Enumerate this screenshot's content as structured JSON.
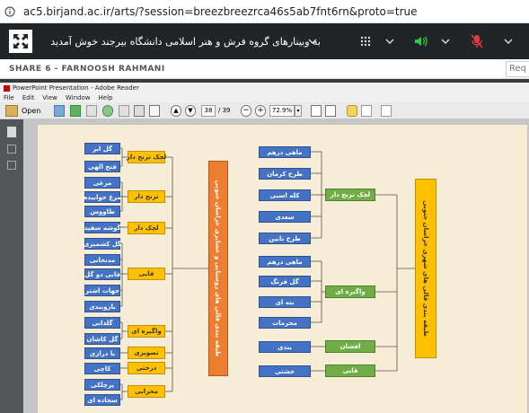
{
  "browser": {
    "url": "ac5.birjand.ac.ir/arts/?session=breezbreezrca46s5ab7fnt6rn&proto=true"
  },
  "meeting": {
    "title": "به وبینارهای گروه فرش و هنر اسلامی دانشگاه بیرجند خوش آمدید",
    "share_label": "SHARE 6  -  FARNOOSH RAHMANI",
    "req_label": "Req",
    "colors": {
      "bar": "#222528",
      "mic_active": "#2ecc40",
      "mic_muted": "#e33b3b"
    }
  },
  "reader": {
    "window_title": "PowerPoint Presentation - Adobe Reader",
    "menu": [
      "File",
      "Edit",
      "View",
      "Window",
      "Help"
    ],
    "open_label": "Open",
    "page_current": "38",
    "page_total": "/ 39",
    "zoom": "72.9%"
  },
  "diagram": {
    "left_blue": [
      "گل ابر",
      "فتح الهی",
      "مرغی",
      "مرغ خوابیده",
      "طاووس",
      "گوشه سفید",
      "گل کشمیری",
      "مدنخانی",
      "قابی دو گل",
      "جهات اشتر",
      "بازوبندی",
      "گلدانی",
      "گل کاشان",
      "با درازی",
      "کاچی",
      "پرچلکی",
      "سجاده ای"
    ],
    "left_yellow": [
      "لچک ترنج دار",
      "ترنج دار",
      "لچک دار",
      "قابی",
      "واگیره ای",
      "تصویری",
      "درختی",
      "محرابی"
    ],
    "left_orange": "طبقه بندی قالی های روستایی و عشایری خراسان جنوبی",
    "right_blue": [
      "ماهی درهم",
      "طرح کرمان",
      "کله اسبی",
      "سعدی",
      "طرح نایین",
      "ماهی درهم",
      "گل فرنگ",
      "بته ای",
      "محرمات",
      "بندی",
      "خشتی"
    ],
    "right_green": [
      "لچک ترنج دار",
      "واگیره ای",
      "افشان",
      "قابی"
    ],
    "right_yellow": "طبقه بندی قالی های شهری خراسان جنوبی"
  }
}
